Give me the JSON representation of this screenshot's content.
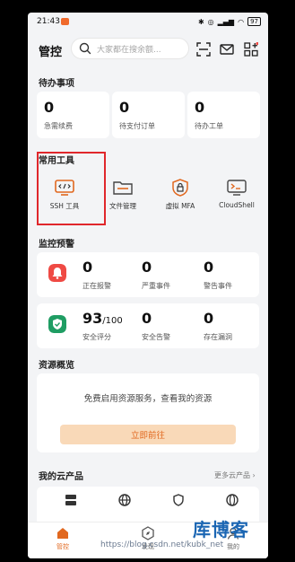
{
  "status_bar": {
    "time": "21:43",
    "battery": "97"
  },
  "header": {
    "title": "管控",
    "search_placeholder": "大家都在搜余额..."
  },
  "todo": {
    "title": "待办事项",
    "items": [
      {
        "count": "0",
        "label": "急需续费"
      },
      {
        "count": "0",
        "label": "待支付订单"
      },
      {
        "count": "0",
        "label": "待办工单"
      }
    ]
  },
  "tools": {
    "title": "常用工具",
    "items": [
      {
        "label": "SSH 工具",
        "icon": "terminal-icon"
      },
      {
        "label": "文件管理",
        "icon": "folder-icon"
      },
      {
        "label": "虚拟 MFA",
        "icon": "shield-lock-icon"
      },
      {
        "label": "CloudShell",
        "icon": "cloudshell-icon"
      }
    ]
  },
  "monitor": {
    "title": "监控预警",
    "alarm_row": [
      {
        "count": "0",
        "label": "正在报警"
      },
      {
        "count": "0",
        "label": "严重事件"
      },
      {
        "count": "0",
        "label": "警告事件"
      }
    ],
    "security_row": {
      "score": "93",
      "score_total": "/100",
      "score_label": "安全评分",
      "items": [
        {
          "count": "0",
          "label": "安全告警"
        },
        {
          "count": "0",
          "label": "存在漏洞"
        }
      ]
    }
  },
  "resources": {
    "title": "资源概览",
    "text": "免费启用资源服务，查看我的资源",
    "button": "立即前往"
  },
  "products": {
    "title": "我的云产品",
    "more": "更多云产品"
  },
  "tabbar": {
    "items": [
      {
        "label": "管控"
      },
      {
        "label": "发现"
      },
      {
        "label": "我的"
      }
    ]
  },
  "watermark": {
    "brand": "库博客",
    "url": "https://blog.csdn.net/kubk_net"
  },
  "colors": {
    "accent": "#e1681f",
    "alert_red": "#ef4a44",
    "safe_green": "#1f9d63",
    "highlight_red": "#e0272b"
  }
}
